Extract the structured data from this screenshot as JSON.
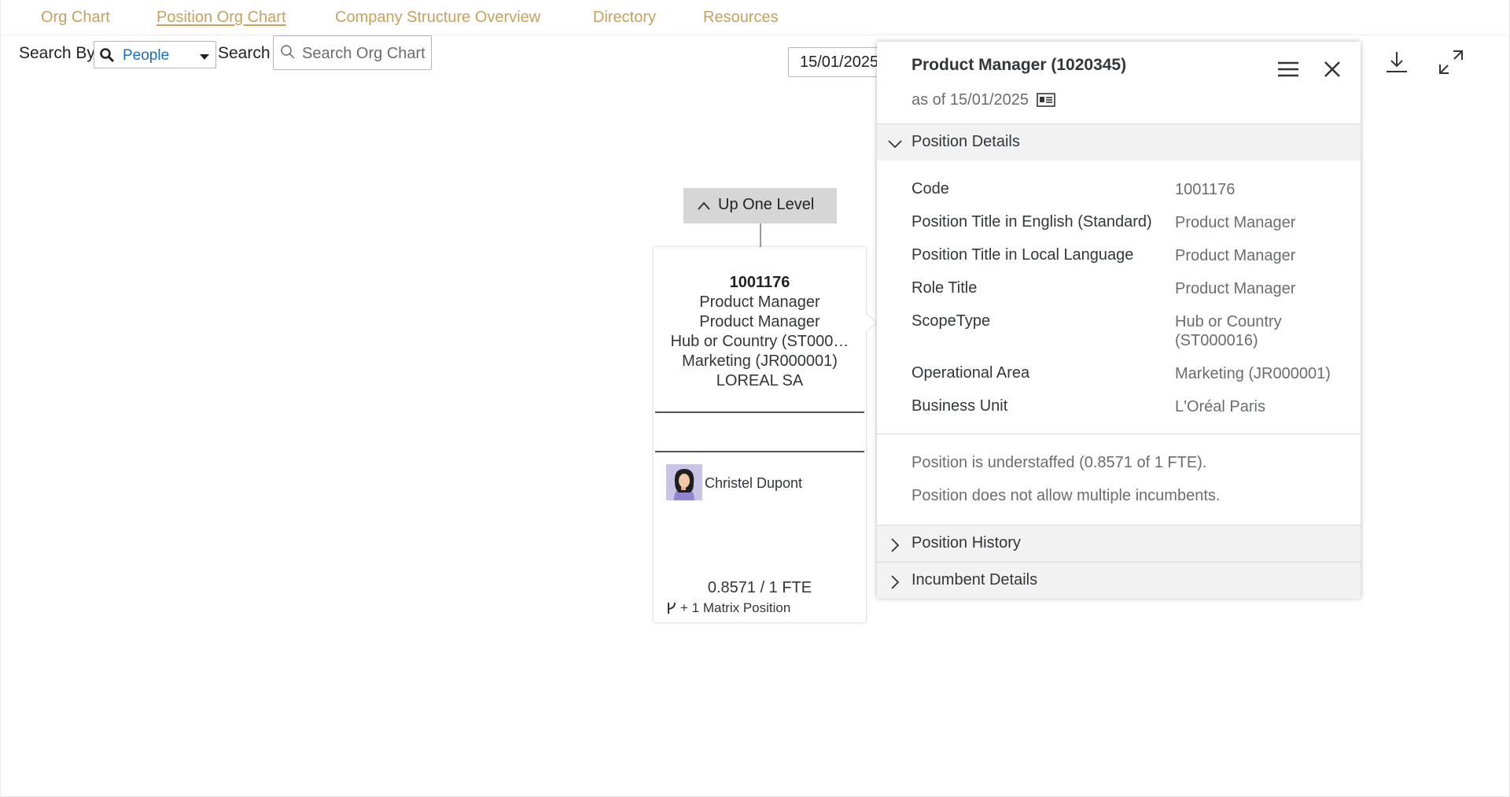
{
  "nav": {
    "tabs": [
      {
        "label": "Org Chart"
      },
      {
        "label": "Position Org Chart"
      },
      {
        "label": "Company Structure Overview"
      },
      {
        "label": "Directory"
      },
      {
        "label": "Resources"
      }
    ],
    "active_tab": "Position Org Chart"
  },
  "search": {
    "search_by_label": "Search By",
    "search_by_value": "People",
    "search_label": "Search",
    "placeholder": "Search Org Chart",
    "date_value": "15/01/2025"
  },
  "toolbar": {
    "icons": [
      "download-icon",
      "fullscreen-icon"
    ]
  },
  "orgcard": {
    "up_level_label": "Up One Level",
    "code": "1001176",
    "lines": [
      "Product Manager",
      "Product Manager",
      "Hub or Country (ST000…",
      "Marketing (JR000001)",
      "LOREAL SA"
    ],
    "incumbent_name": "Christel Dupont",
    "fte": "0.8571 / 1 FTE",
    "matrix": "+ 1 Matrix Position"
  },
  "popover": {
    "title": "Product Manager (1020345)",
    "as_of": "as of 15/01/2025",
    "sections": {
      "details": "Position Details",
      "history": "Position History",
      "incumbent": "Incumbent Details"
    },
    "details": [
      {
        "key": "Code",
        "value": "1001176"
      },
      {
        "key": "Position Title in English (Standard)",
        "value": "Product Manager"
      },
      {
        "key": "Position Title in Local Language",
        "value": "Product Manager"
      },
      {
        "key": "Role Title",
        "value": "Product Manager"
      },
      {
        "key": "ScopeType",
        "value": "Hub or Country (ST000016)"
      },
      {
        "key": "Operational Area",
        "value": "Marketing (JR000001)"
      },
      {
        "key": "Business Unit",
        "value": "L'Oréal Paris"
      }
    ],
    "messages": [
      "Position is understaffed (0.8571 of 1 FTE).",
      "Position does not allow multiple incumbents."
    ]
  },
  "colors": {
    "nav_link": "#c8a15a",
    "select_value": "#1a6fb8",
    "section_bg": "#f2f2f2",
    "up_button_bg": "#d6d6d6"
  }
}
